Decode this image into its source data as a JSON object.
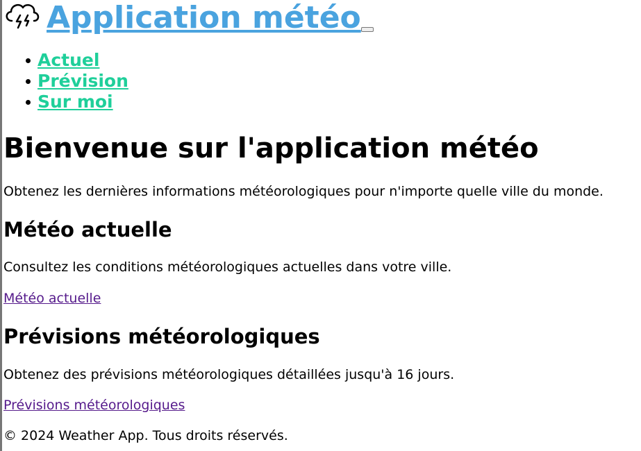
{
  "header": {
    "title": "Application météo",
    "logo_icon": "cloud-lightning-icon"
  },
  "nav": {
    "items": [
      {
        "label": "Actuel"
      },
      {
        "label": "Prévision"
      },
      {
        "label": "Sur moi"
      }
    ]
  },
  "main": {
    "heading": "Bienvenue sur l'application météo",
    "intro": "Obtenez les dernières informations météorologiques pour n'importe quelle ville du monde.",
    "current": {
      "heading": "Météo actuelle",
      "text": "Consultez les conditions météorologiques actuelles dans votre ville.",
      "link": "Météo actuelle"
    },
    "forecast": {
      "heading": "Prévisions météorologiques",
      "text": "Obtenez des prévisions météorologiques détaillées jusqu'à 16 jours.",
      "link": "Prévisions météorologiques"
    }
  },
  "footer": {
    "text": "© 2024 Weather App. Tous droits réservés."
  },
  "colors": {
    "title": "#4aa3df",
    "nav_link": "#1fcf9a",
    "visited_link": "#551a8b"
  }
}
